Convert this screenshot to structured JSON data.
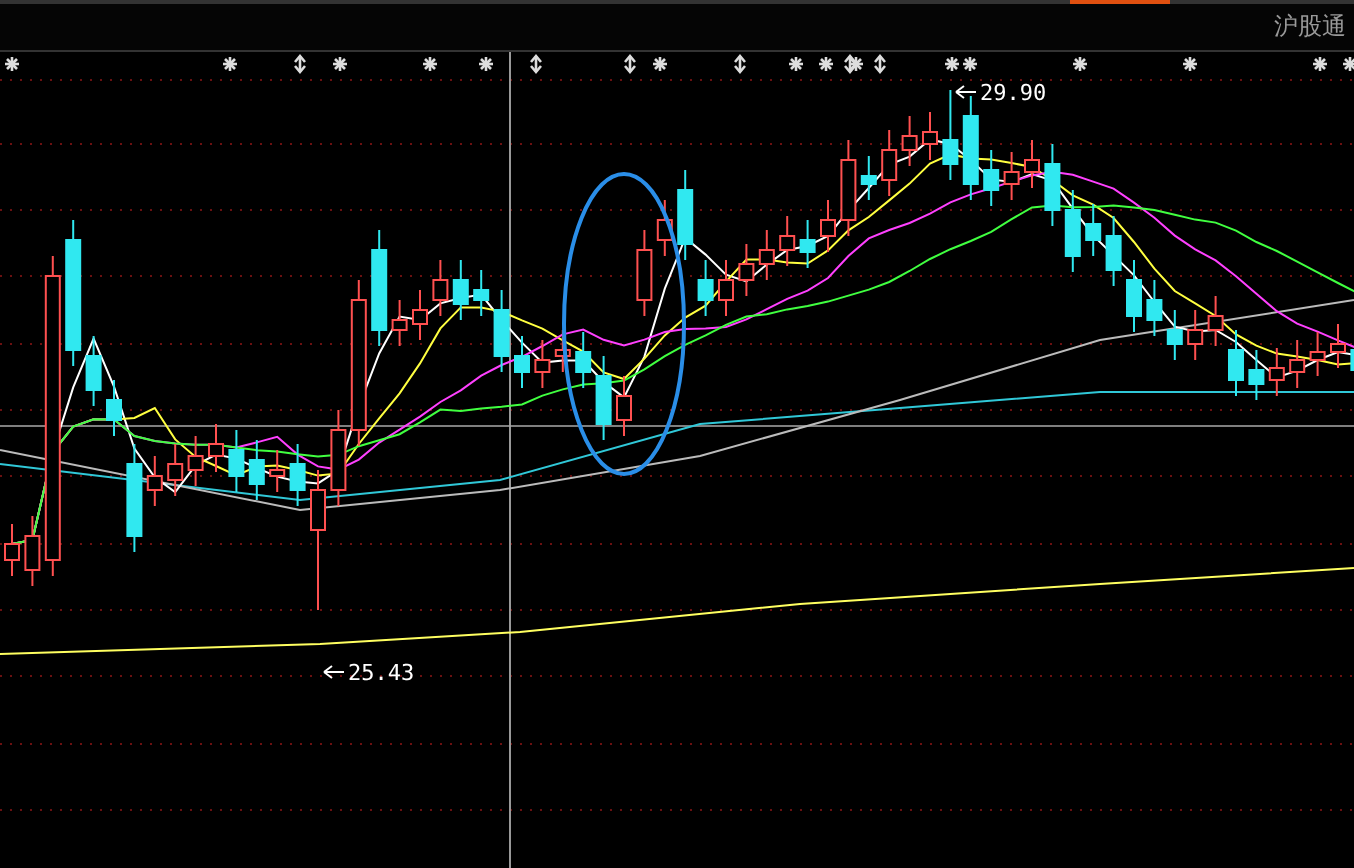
{
  "header": {
    "tab_label": "沪股通"
  },
  "chart": {
    "high_price_label": "29.90",
    "low_price_label": "25.43"
  }
}
